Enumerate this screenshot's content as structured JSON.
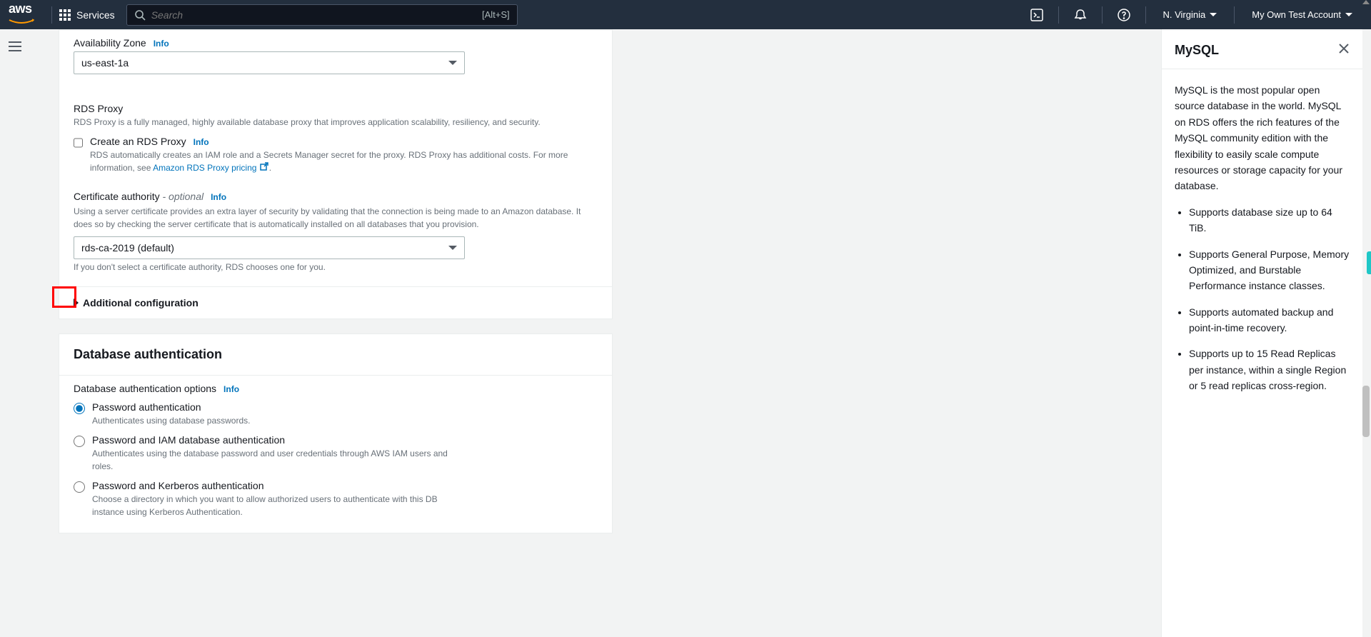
{
  "topnav": {
    "services_label": "Services",
    "search_placeholder": "Search",
    "search_hint": "[Alt+S]",
    "region": "N. Virginia",
    "account": "My Own Test Account"
  },
  "availability_zone": {
    "label": "Availability Zone",
    "info": "Info",
    "value": "us-east-1a"
  },
  "rds_proxy": {
    "heading": "RDS Proxy",
    "desc": "RDS Proxy is a fully managed, highly available database proxy that improves application scalability, resiliency, and security.",
    "checkbox_label": "Create an RDS Proxy",
    "info": "Info",
    "checkbox_desc_a": "RDS automatically creates an IAM role and a Secrets Manager secret for the proxy. RDS Proxy has additional costs. For more information, see ",
    "pricing_link": "Amazon RDS Proxy pricing",
    "period": "."
  },
  "cert_authority": {
    "label": "Certificate authority",
    "optional": " - optional",
    "info": "Info",
    "desc": "Using a server certificate provides an extra layer of security by validating that the connection is being made to an Amazon database. It does so by checking the server certificate that is automatically installed on all databases that you provision.",
    "value": "rds-ca-2019 (default)",
    "below": "If you don't select a certificate authority, RDS chooses one for you."
  },
  "additional_config": {
    "label": "Additional configuration"
  },
  "db_auth": {
    "header": "Database authentication",
    "options_label": "Database authentication options",
    "info": "Info",
    "options": [
      {
        "label": "Password authentication",
        "desc": "Authenticates using database passwords."
      },
      {
        "label": "Password and IAM database authentication",
        "desc": "Authenticates using the database password and user credentials through AWS IAM users and roles."
      },
      {
        "label": "Password and Kerberos authentication",
        "desc": "Choose a directory in which you want to allow authorized users to authenticate with this DB instance using Kerberos Authentication."
      }
    ]
  },
  "help_panel": {
    "title": "MySQL",
    "intro": "MySQL is the most popular open source database in the world. MySQL on RDS offers the rich features of the MySQL community edition with the flexibility to easily scale compute resources or storage capacity for your database.",
    "bullets": [
      "Supports database size up to 64 TiB.",
      "Supports General Purpose, Memory Optimized, and Burstable Performance instance classes.",
      "Supports automated backup and point-in-time recovery.",
      "Supports up to 15 Read Replicas per instance, within a single Region or 5 read replicas cross-region."
    ]
  }
}
